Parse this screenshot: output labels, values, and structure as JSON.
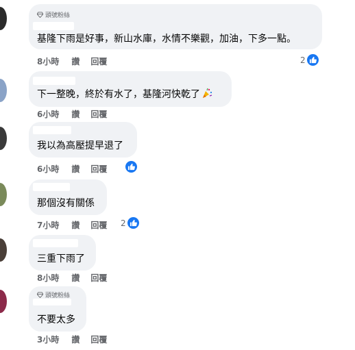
{
  "actions": {
    "like": "讚",
    "reply": "回覆"
  },
  "comments": [
    {
      "badge": "頭號粉絲",
      "text": "基隆下雨是好事，新山水庫，水情不樂觀，加油，下多一點。",
      "time": "8小時",
      "likes": "2"
    },
    {
      "text": "下一整晚，終於有水了，基隆河快乾了",
      "emoji": "party-popper-icon",
      "time": "6小時"
    },
    {
      "text": "我以為高壓提早退了",
      "time": "6小時",
      "likes": ""
    },
    {
      "text": "那個沒有關係",
      "time": "7小時",
      "likes": "2"
    },
    {
      "text": "三重下雨了",
      "time": "8小時"
    },
    {
      "badge": "頭號粉絲",
      "text": "不要太多",
      "time": "3小時"
    }
  ],
  "colors": {
    "bubble": "#f0f2f5",
    "meta_text": "#65676b",
    "like_blue": "#1877f2"
  }
}
